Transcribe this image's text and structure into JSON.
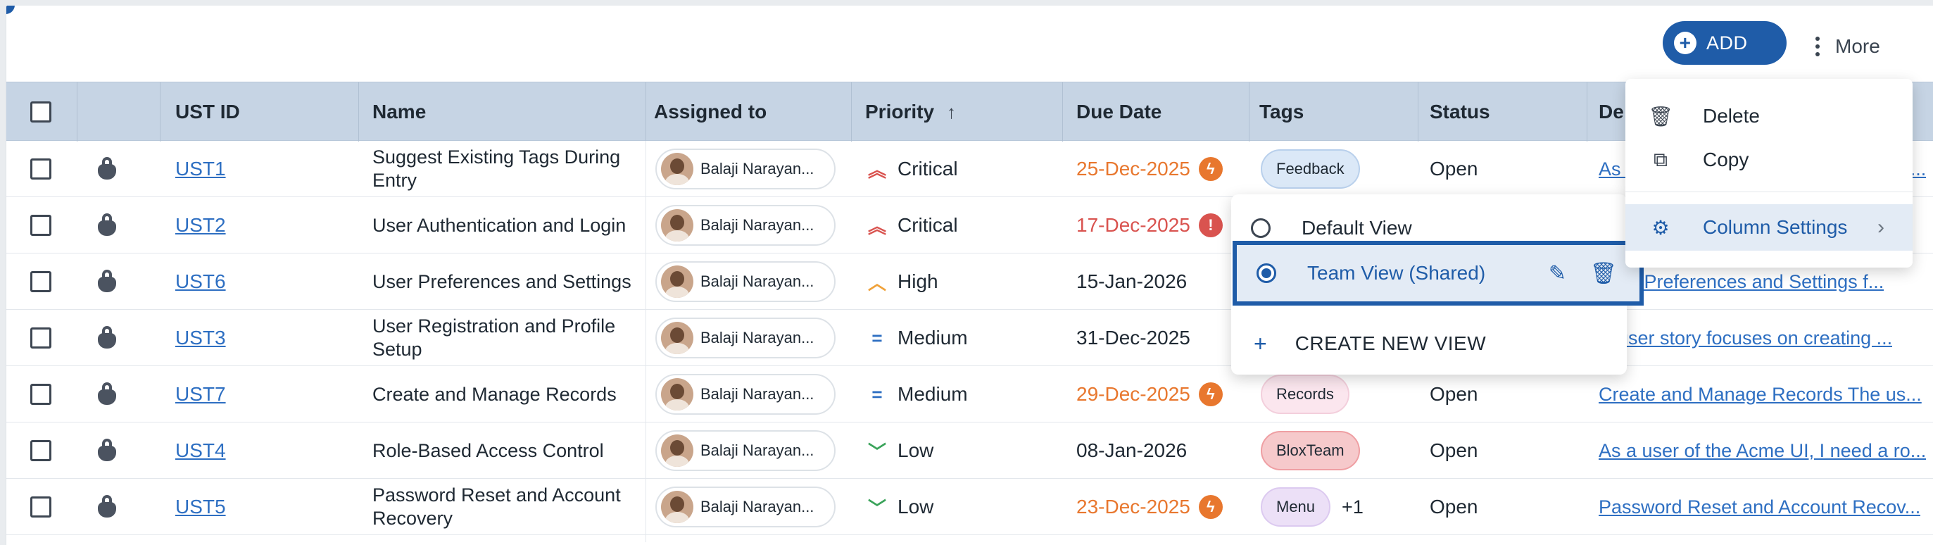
{
  "toolbar": {
    "add_label": "ADD",
    "more_label": "More"
  },
  "table": {
    "headers": {
      "ust_id": "UST ID",
      "name": "Name",
      "assigned": "Assigned to",
      "priority": "Priority",
      "due": "Due Date",
      "tags": "Tags",
      "status": "Status",
      "description": "De"
    },
    "rows": [
      {
        "id": "UST1",
        "name": "Suggest Existing Tags During Entry",
        "assigned": "Balaji Narayan...",
        "priority": "Critical",
        "priority_icon": "double-chevron-up",
        "priority_color": "#d9534f",
        "due": "25-Dec-2025",
        "due_color": "#e8772e",
        "due_icon": "bolt",
        "tag": "Feedback",
        "tag_bg": "#dbe8f7",
        "tag_border": "#b9d0ec",
        "extra": "",
        "status": "Open",
        "desc": "As a user of the Acme UI, I need a ro..."
      },
      {
        "id": "UST2",
        "name": "User Authentication and Login",
        "assigned": "Balaji Narayan...",
        "priority": "Critical",
        "priority_icon": "double-chevron-up",
        "priority_color": "#d9534f",
        "due": "17-Dec-2025",
        "due_color": "#d9534f",
        "due_icon": "exclamation",
        "tag": "",
        "tag_bg": "",
        "tag_border": "",
        "extra": "",
        "status": "",
        "desc": ""
      },
      {
        "id": "UST6",
        "name": "User Preferences and Settings",
        "assigned": "Balaji Narayan...",
        "priority": "High",
        "priority_icon": "chevron-up",
        "priority_color": "#f0a23a",
        "due": "15-Jan-2026",
        "due_color": "#1f2933",
        "due_icon": "",
        "tag": "",
        "tag_bg": "",
        "tag_border": "",
        "extra": "",
        "status": "",
        "desc": "User Preferences and Settings f..."
      },
      {
        "id": "UST3",
        "name": "User Registration and Profile Setup",
        "assigned": "Balaji Narayan...",
        "priority": "Medium",
        "priority_icon": "equals",
        "priority_color": "#2e6fc2",
        "due": "31-Dec-2025",
        "due_color": "#1f2933",
        "due_icon": "",
        "tag": "",
        "tag_bg": "",
        "tag_border": "",
        "extra": "",
        "status": "",
        "desc": "is user story focuses on creating ..."
      },
      {
        "id": "UST7",
        "name": "Create and Manage Records",
        "assigned": "Balaji Narayan...",
        "priority": "Medium",
        "priority_icon": "equals",
        "priority_color": "#2e6fc2",
        "due": "29-Dec-2025",
        "due_color": "#e8772e",
        "due_icon": "bolt",
        "tag": "Records",
        "tag_bg": "#fbe6ee",
        "tag_border": "#f3cfdc",
        "extra": "",
        "status": "Open",
        "desc": "Create and Manage Records The us..."
      },
      {
        "id": "UST4",
        "name": "Role-Based Access Control",
        "assigned": "Balaji Narayan...",
        "priority": "Low",
        "priority_icon": "chevron-down",
        "priority_color": "#3aa35a",
        "due": "08-Jan-2026",
        "due_color": "#1f2933",
        "due_icon": "",
        "tag": "BloxTeam",
        "tag_bg": "#f6c9cb",
        "tag_border": "#ef9fa3",
        "extra": "",
        "status": "Open",
        "desc": "As a user of the Acme UI, I need a ro..."
      },
      {
        "id": "UST5",
        "name": "Password Reset and Account Recovery",
        "assigned": "Balaji Narayan...",
        "priority": "Low",
        "priority_icon": "chevron-down",
        "priority_color": "#3aa35a",
        "due": "23-Dec-2025",
        "due_color": "#e8772e",
        "due_icon": "bolt",
        "tag": "Menu",
        "tag_bg": "#ece0f7",
        "tag_border": "#dccaf0",
        "extra": "+1",
        "status": "Open",
        "desc": "Password Reset and Account Recov..."
      }
    ]
  },
  "view_menu": {
    "items": [
      {
        "label": "Default View",
        "selected": false
      },
      {
        "label": "Team View (Shared)",
        "selected": true
      }
    ],
    "create_label": "CREATE NEW VIEW"
  },
  "more_menu": {
    "items": [
      {
        "label": "Delete",
        "icon": "trash-icon"
      },
      {
        "label": "Copy",
        "icon": "copy-icon"
      },
      {
        "label": "Column Settings",
        "icon": "gear-icon"
      }
    ]
  },
  "colors": {
    "accent": "#1f5ca8",
    "header_bg": "#c6d4e4",
    "link": "#2e6fc2"
  }
}
